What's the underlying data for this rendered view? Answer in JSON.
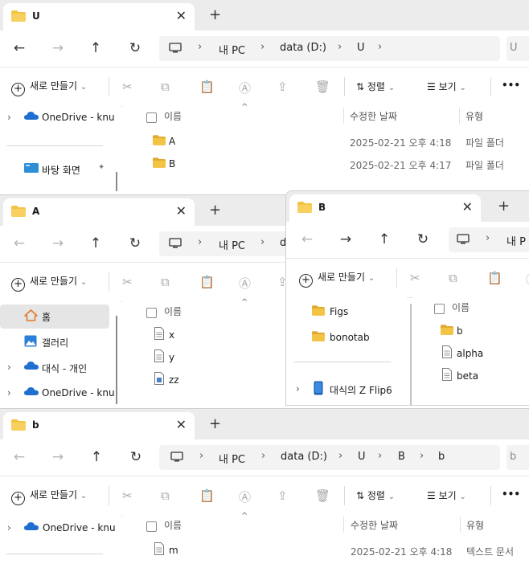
{
  "windows": {
    "u": {
      "tab_title": "U",
      "address": [
        "내 PC",
        "data (D:)",
        "U"
      ],
      "search_partial": "U",
      "toolbar": {
        "new": "새로 만들기",
        "sort": "정렬",
        "view": "보기",
        "more": "•••"
      },
      "sidebar": [
        {
          "label": "OneDrive - knu",
          "expand": "›"
        },
        {
          "label": "바탕 화면"
        }
      ],
      "columns": {
        "name": "이름",
        "date": "수정한 날짜",
        "type": "유형"
      },
      "rows": [
        {
          "name": "A",
          "date": "2025-02-21 오후 4:18",
          "type": "파일 폴더"
        },
        {
          "name": "B",
          "date": "2025-02-21 오후 4:17",
          "type": "파일 폴더"
        }
      ]
    },
    "a": {
      "tab_title": "A",
      "address": [
        "내 PC",
        "d"
      ],
      "toolbar": {
        "new": "새로 만들기"
      },
      "sidebar": [
        {
          "label": "홈"
        },
        {
          "label": "갤러리"
        },
        {
          "label": "대식 - 개인",
          "expand": "›"
        },
        {
          "label": "OneDrive - knu",
          "expand": "›"
        }
      ],
      "columns": {
        "name": "이름"
      },
      "rows": [
        {
          "name": "x"
        },
        {
          "name": "y"
        },
        {
          "name": "zz"
        }
      ]
    },
    "b_upper": {
      "tab_title": "B",
      "address": [
        "내 P"
      ],
      "toolbar": {
        "new": "새로 만들기"
      },
      "sidebar": [
        {
          "label": "Figs"
        },
        {
          "label": "bonotab"
        },
        {
          "label": "대식의 Z Flip6",
          "expand": "›"
        }
      ],
      "columns": {
        "name": "이름"
      },
      "rows": [
        {
          "name": "b"
        },
        {
          "name": "alpha"
        },
        {
          "name": "beta"
        }
      ]
    },
    "b_lower": {
      "tab_title": "b",
      "address": [
        "내 PC",
        "data (D:)",
        "U",
        "B",
        "b"
      ],
      "search_partial": "b",
      "toolbar": {
        "new": "새로 만들기",
        "sort": "정렬",
        "view": "보기",
        "more": "•••"
      },
      "sidebar": [
        {
          "label": "OneDrive - knu",
          "expand": "›"
        }
      ],
      "columns": {
        "name": "이름",
        "date": "수정한 날짜",
        "type": "유형"
      },
      "rows": [
        {
          "name": "m",
          "date": "2025-02-21 오후 4:18",
          "type": "텍스트 문서"
        }
      ]
    }
  },
  "glyphs": {
    "close": "✕",
    "new_tab": "+",
    "back": "←",
    "forward": "→",
    "up": "↑",
    "refresh": "↻",
    "chevron": "›",
    "dropdown": "⌄",
    "sort_caret": "^",
    "pin": "📌"
  },
  "colors": {
    "folder": "#f3c343",
    "folder_dark": "#e0a82e",
    "onedrive": "#1f6fd1",
    "home": "#e07b2c",
    "gallery": "#2b7fd6",
    "tabstrip": "#ececec"
  }
}
